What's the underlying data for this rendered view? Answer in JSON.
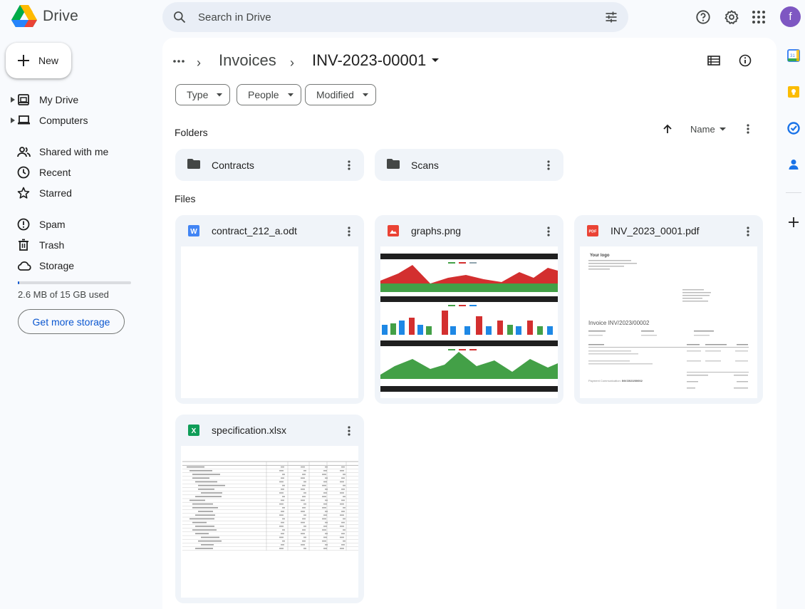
{
  "app": {
    "title": "Drive"
  },
  "search": {
    "placeholder": "Search in Drive"
  },
  "user": {
    "avatar_letter": "f"
  },
  "sidebar": {
    "new_label": "New",
    "items": [
      {
        "label": "My Drive",
        "icon": "my-drive-icon"
      },
      {
        "label": "Computers",
        "icon": "computers-icon"
      },
      {
        "label": "Shared with me",
        "icon": "shared-icon"
      },
      {
        "label": "Recent",
        "icon": "clock-icon"
      },
      {
        "label": "Starred",
        "icon": "star-icon"
      },
      {
        "label": "Spam",
        "icon": "spam-icon"
      },
      {
        "label": "Trash",
        "icon": "trash-icon"
      },
      {
        "label": "Storage",
        "icon": "cloud-icon"
      }
    ],
    "storage_used_fraction": 0.0002,
    "storage_text": "2.6 MB of 15 GB used",
    "get_more_storage": "Get more storage"
  },
  "breadcrumb": {
    "overflow": "...",
    "parent": "Invoices",
    "current": "INV-2023-00001"
  },
  "filters": [
    "Type",
    "People",
    "Modified"
  ],
  "sections": {
    "folders": "Folders",
    "files": "Files"
  },
  "sort": {
    "label": "Name"
  },
  "folders": [
    {
      "name": "Contracts"
    },
    {
      "name": "Scans"
    }
  ],
  "files": [
    {
      "name": "contract_212_a.odt",
      "type": "doc",
      "icon_letter": "W"
    },
    {
      "name": "graphs.png",
      "type": "image"
    },
    {
      "name": "INV_2023_0001.pdf",
      "type": "pdf",
      "icon_letter": "PDF"
    },
    {
      "name": "specification.xlsx",
      "type": "sheet",
      "icon_letter": "X"
    }
  ],
  "invoice_preview": {
    "logo": "Your logo",
    "title": "Invoice INV/2023/00002",
    "label_comm": "Payment Communication:",
    "comm_value": "INV/2023/00002"
  },
  "colors": {
    "accent": "#0b57d0",
    "doc": "#4285f4",
    "image": "#ea4335",
    "pdf": "#ea4335",
    "sheet": "#0f9d58"
  }
}
